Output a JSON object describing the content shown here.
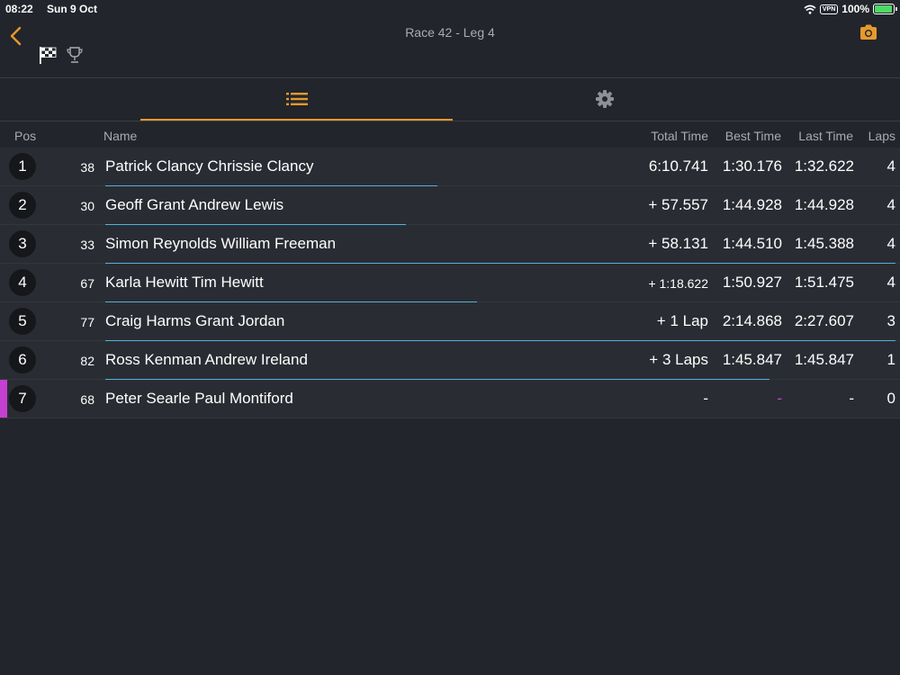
{
  "status_bar": {
    "time": "08:22",
    "date": "Sun 9 Oct",
    "vpn": "VPN",
    "battery": "100%"
  },
  "nav": {
    "title": "Race 42 -  Leg 4"
  },
  "colors": {
    "accent": "#e59a2c",
    "purple": "#d23ed8",
    "progress": "#4fb3d9"
  },
  "icons": {
    "back": "chevron-left-icon",
    "camera": "camera-icon",
    "flag": "checkered-flag-icon",
    "trophy": "trophy-icon",
    "list_tab": "list-icon",
    "settings_tab": "gear-icon"
  },
  "table": {
    "headers": {
      "pos": "Pos",
      "name": "Name",
      "total": "Total Time",
      "best": "Best Time",
      "last": "Last Time",
      "laps": "Laps"
    },
    "rows": [
      {
        "pos": "1",
        "car": "38",
        "name": "Patrick Clancy Chrissie Clancy",
        "total": "6:10.741",
        "best": "1:30.176",
        "last": "1:32.622",
        "laps": "4",
        "progress": 0.42
      },
      {
        "pos": "2",
        "car": "30",
        "name": "Geoff Grant Andrew Lewis",
        "total": "+ 57.557",
        "best": "1:44.928",
        "last": "1:44.928",
        "laps": "4",
        "progress": 0.38
      },
      {
        "pos": "3",
        "car": "33",
        "name": "Simon Reynolds William Freeman",
        "total": "+ 58.131",
        "best": "1:44.510",
        "last": "1:45.388",
        "laps": "4",
        "progress": 1.0
      },
      {
        "pos": "4",
        "car": "67",
        "name": "Karla Hewitt Tim Hewitt",
        "total": "+ 1:18.622",
        "best": "1:50.927",
        "last": "1:51.475",
        "laps": "4",
        "progress": 0.47
      },
      {
        "pos": "5",
        "car": "77",
        "name": "Craig Harms Grant Jordan",
        "total": "+ 1 Lap",
        "best": "2:14.868",
        "last": "2:27.607",
        "laps": "3",
        "progress": 1.0
      },
      {
        "pos": "6",
        "car": "82",
        "name": "Ross Kenman Andrew Ireland",
        "total": "+ 3 Laps",
        "best": "1:45.847",
        "last": "1:45.847",
        "laps": "1",
        "progress": 0.84
      },
      {
        "pos": "7",
        "car": "68",
        "name": "Peter Searle Paul Montiford",
        "total": "-",
        "best": "-",
        "last": "-",
        "laps": "0",
        "progress": 0
      }
    ]
  }
}
